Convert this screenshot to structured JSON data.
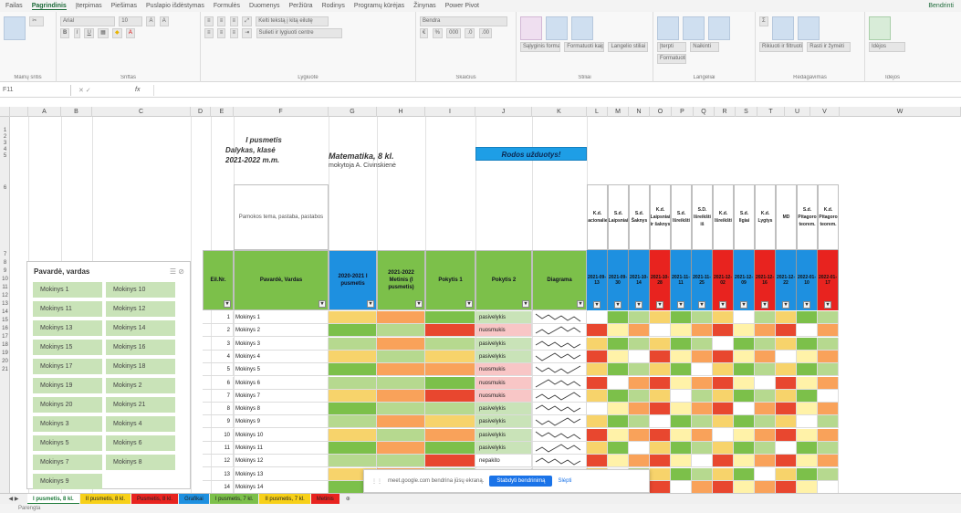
{
  "ribbon": {
    "tabs": [
      "Failas",
      "Pagrindinis",
      "Įterpimas",
      "Piešimas",
      "Puslapio išdėstymas",
      "Formulės",
      "Duomenys",
      "Peržiūra",
      "Rodinys",
      "Programų kūrėjas",
      "Žinynas",
      "Power Pivot"
    ],
    "active_tab": "Pagrindinis",
    "right_button": "Bendrinti",
    "font_name": "Arial",
    "font_size": "10",
    "number_format": "Bendra",
    "wrap_text": "Kelti tekstą į kitą eilutę",
    "merge_center": "Sulieti ir lygiuoti centre",
    "groups": [
      "Mainų sritis",
      "Šriftas",
      "Lygiuotė",
      "Skaičius",
      "Stiliai",
      "Langeliai",
      "Redagavimas",
      "Idėjos"
    ],
    "styles": [
      "Sąlyginis formatavimas",
      "Formatuoti kaip lentelę",
      "Langelio stiliai"
    ],
    "cells": [
      "Įterpti",
      "Naikinti",
      "Formatuoti"
    ],
    "editing": [
      "Rikiuoti ir filtruoti",
      "Rasti ir žymėti"
    ],
    "ideas": "Idėjos"
  },
  "formula_bar": {
    "name_box": "F11",
    "fx": "fx",
    "value": ""
  },
  "columns": [
    "A",
    "B",
    "C",
    "D",
    "E",
    "F",
    "G",
    "H",
    "I",
    "J",
    "K",
    "L",
    "M",
    "N",
    "O",
    "P",
    "Q",
    "R",
    "S",
    "T",
    "U",
    "V",
    "W"
  ],
  "rows": [
    "1",
    "2",
    "3",
    "4",
    "5",
    "6",
    "7",
    "8",
    "9",
    "10",
    "11",
    "12",
    "13",
    "14",
    "15",
    "16",
    "17",
    "18",
    "19",
    "20",
    "21"
  ],
  "header": {
    "title_lines": [
      "I pusmetis",
      "Dalykas, klasė",
      "2021-2022 m.m."
    ],
    "subject": "Matematika, 8 kl.",
    "teacher": "mokytoja A. Civinskienė",
    "button": "Rodos užduotys!",
    "notes_label": "Pamokos tema, pastaba, pastabos",
    "col_nr": "Eil.Nr.",
    "col_name": "Pavardė, Vardas",
    "col_2021": "2020-2021 I pusmetis",
    "col_2022": "2021-2022 Metinis (I pusmetis)",
    "col_p1": "Pokytis 1",
    "col_p2": "Pokytis 2",
    "col_diag": "Diagrama"
  },
  "assessments": [
    {
      "label": "K.d. Racionalieji",
      "date": "2021-09-13",
      "color": "#1e90e0"
    },
    {
      "label": "S.d. Laipsniai",
      "date": "2021-09-30",
      "color": "#1e90e0"
    },
    {
      "label": "S.d. Šaknys",
      "date": "2021-10-14",
      "color": "#1e90e0"
    },
    {
      "label": "K.d. Laipsniai ir šaknys",
      "date": "2021-10-28",
      "color": "#e8231f"
    },
    {
      "label": "S.d. Išreikšti",
      "date": "2021-11-11",
      "color": "#1e90e0"
    },
    {
      "label": "S.D. Išreikšti iš",
      "date": "2021-11-25",
      "color": "#1e90e0"
    },
    {
      "label": "K.d. Išreikšti",
      "date": "2021-12-02",
      "color": "#e8231f"
    },
    {
      "label": "S.d. Ilgiai",
      "date": "2021-12-09",
      "color": "#1e90e0"
    },
    {
      "label": "K.d. Lygtys",
      "date": "2021-12-16",
      "color": "#e8231f"
    },
    {
      "label": "MD",
      "date": "2021-12-22",
      "color": "#1e90e0"
    },
    {
      "label": "S.d. Pitagoro teorem.",
      "date": "2022-01-10",
      "color": "#1e90e0"
    },
    {
      "label": "K.d. Pitagoro teorem.",
      "date": "2022-01-17",
      "color": "#e8231f"
    }
  ],
  "slicer": {
    "title": "Pavardė, vardas",
    "items": [
      "Mokinys 1",
      "Mokinys 10",
      "Mokinys 11",
      "Mokinys 12",
      "Mokinys 13",
      "Mokinys 14",
      "Mokinys 15",
      "Mokinys 16",
      "Mokinys 17",
      "Mokinys 18",
      "Mokinys 19",
      "Mokinys 2",
      "Mokinys 20",
      "Mokinys 21",
      "Mokinys 3",
      "Mokinys 4",
      "Mokinys 5",
      "Mokinys 6",
      "Mokinys 7",
      "Mokinys 8",
      "Mokinys 9"
    ]
  },
  "students": [
    {
      "nr": "1",
      "name": "Mokinys 1",
      "p1": "",
      "p2": "pasivelykis"
    },
    {
      "nr": "2",
      "name": "Mokinys 2",
      "p1": "",
      "p2": "nuosmukis"
    },
    {
      "nr": "3",
      "name": "Mokinys 3",
      "p1": "",
      "p2": "pasivelykis"
    },
    {
      "nr": "4",
      "name": "Mokinys 4",
      "p1": "",
      "p2": "pasivelykis"
    },
    {
      "nr": "5",
      "name": "Mokinys 5",
      "p1": "",
      "p2": "nuosmukis"
    },
    {
      "nr": "6",
      "name": "Mokinys 6",
      "p1": "",
      "p2": "nuosmukis"
    },
    {
      "nr": "7",
      "name": "Mokinys 7",
      "p1": "",
      "p2": "nuosmukis"
    },
    {
      "nr": "8",
      "name": "Mokinys 8",
      "p1": "",
      "p2": "pasivelykis"
    },
    {
      "nr": "9",
      "name": "Mokinys 9",
      "p1": "",
      "p2": "pasivelykis"
    },
    {
      "nr": "10",
      "name": "Mokinys 10",
      "p1": "",
      "p2": "pasivelykis"
    },
    {
      "nr": "11",
      "name": "Mokinys 11",
      "p1": "",
      "p2": "pasivelykis"
    },
    {
      "nr": "12",
      "name": "Mokinys 12",
      "p1": "",
      "p2": "nepakito"
    },
    {
      "nr": "13",
      "name": "Mokinys 13",
      "p1": "",
      "p2": ""
    },
    {
      "nr": "14",
      "name": "Mokinys 14",
      "p1": "",
      "p2": ""
    }
  ],
  "popup": {
    "text": "meet.google.com bendrina jūsų ekraną.",
    "stop": "Stabdyti bendrinimą",
    "hide": "Slėpti"
  },
  "sheet_tabs": [
    {
      "label": "I pusmetis, 8 kl.",
      "color": "#ffffff",
      "active": true
    },
    {
      "label": "II pusmetis, 8 kl.",
      "color": "#f7d018",
      "active": false
    },
    {
      "label": "Pusmetis, 8 kl.",
      "color": "#e8231f",
      "active": false
    },
    {
      "label": "Grafikai",
      "color": "#1e90e0",
      "active": false
    },
    {
      "label": "I pusmetis, 7 kl.",
      "color": "#7cc04a",
      "active": false
    },
    {
      "label": "II pusmetis, 7 kl.",
      "color": "#f7d018",
      "active": false
    },
    {
      "label": "Metinis",
      "color": "#e8231f",
      "active": false
    }
  ],
  "status_text": "Parengta",
  "colors": {
    "green": "#7cc04a",
    "blue": "#1e90e0",
    "red": "#e8231f",
    "yellow": "#fbe27a",
    "lightgreen": "#c9e3b8",
    "pink": "#f8c6c6"
  }
}
